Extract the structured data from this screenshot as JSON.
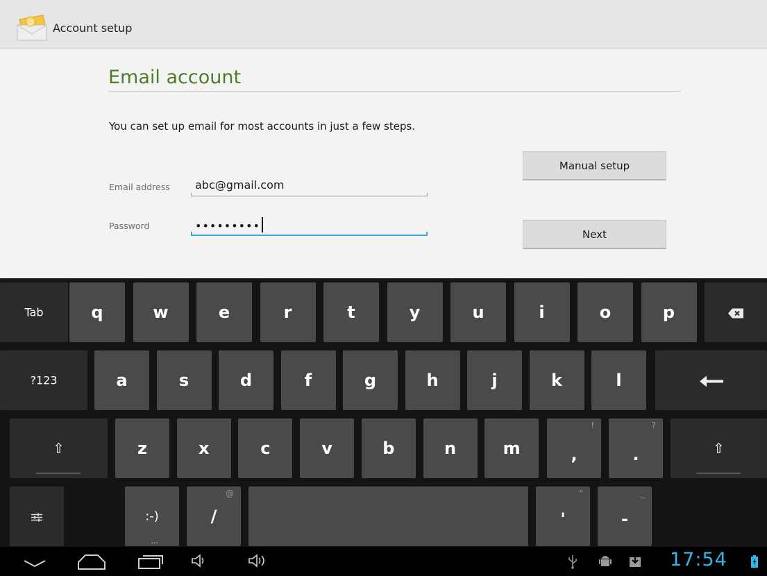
{
  "action_bar": {
    "title": "Account setup"
  },
  "form": {
    "heading": "Email account",
    "intro": "You can set up email for most accounts in just a few steps.",
    "email": {
      "label": "Email address",
      "value": "abc@gmail.com"
    },
    "password": {
      "label": "Password",
      "value": "•••••••••"
    },
    "manual_setup_label": "Manual setup",
    "next_label": "Next"
  },
  "keyboard": {
    "row1": {
      "tab": "Tab",
      "keys": [
        "q",
        "w",
        "e",
        "r",
        "t",
        "y",
        "u",
        "i",
        "o",
        "p"
      ]
    },
    "row2": {
      "mode": "?123",
      "keys": [
        "a",
        "s",
        "d",
        "f",
        "g",
        "h",
        "j",
        "k",
        "l"
      ],
      "enter": "⏎"
    },
    "row3": {
      "shift": "⇧",
      "keys": [
        "z",
        "x",
        "c",
        "v",
        "b",
        "n",
        "m"
      ],
      "comma": ",",
      "comma_hint": "!",
      "period": ".",
      "period_hint": "?"
    },
    "row4": {
      "settings": "⚙",
      "smiley": ":-)",
      "smiley_more": "...",
      "slash": "/",
      "slash_hint": "@",
      "apostrophe": "'",
      "apostrophe_hint": "\"",
      "dash": "-",
      "dash_hint": "_"
    }
  },
  "status_bar": {
    "time": "17:54"
  },
  "colors": {
    "heading": "#4e7d28",
    "focus": "#33a8d8",
    "clock": "#33b5e5"
  }
}
